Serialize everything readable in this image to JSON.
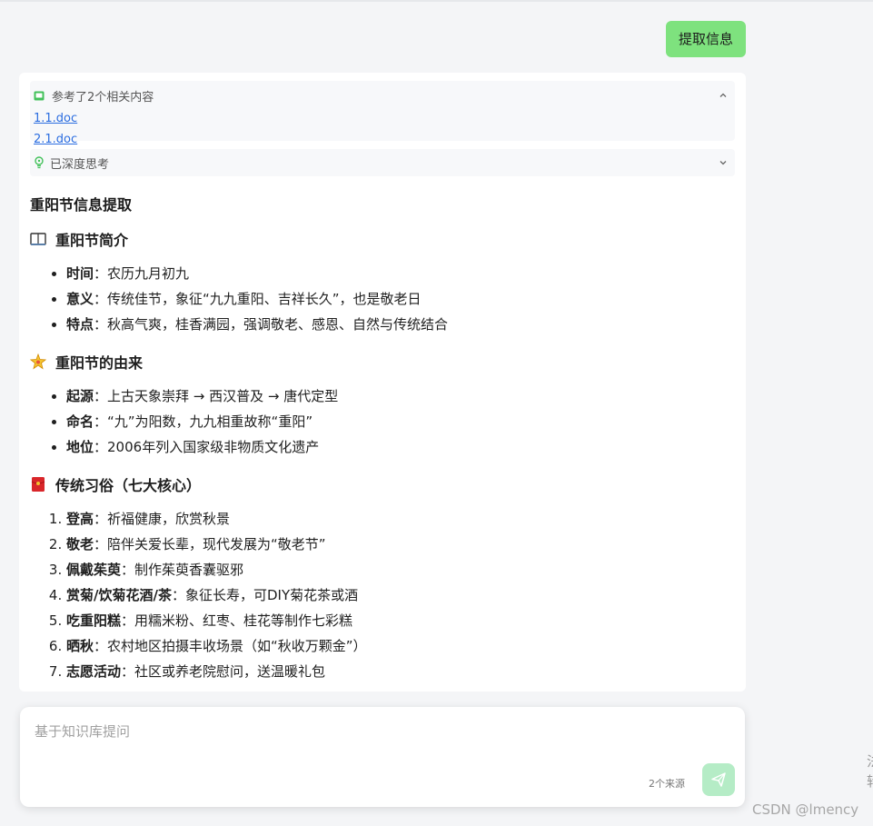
{
  "toolbar": {
    "extract_label": "提取信息"
  },
  "references": {
    "heading": "参考了2个相关内容",
    "files": [
      "1.1.doc",
      "2.1.doc"
    ]
  },
  "thinking": {
    "label": "已深度思考"
  },
  "answer": {
    "title": "重阳节信息提取",
    "sections": [
      {
        "heading": "重阳节简介",
        "icon": "book-icon",
        "items": [
          {
            "key": "时间",
            "value": "：农历九月初九"
          },
          {
            "key": "意义",
            "value": "：传统佳节，象征“九九重阳、吉祥长久”，也是敬老日"
          },
          {
            "key": "特点",
            "value": "：秋高气爽，桂香满园，强调敬老、感恩、自然与传统结合"
          }
        ]
      },
      {
        "heading": "重阳节的由来",
        "icon": "sparkle-icon",
        "items": [
          {
            "key": "起源",
            "value": "：上古天象崇拜 → 西汉普及 → 唐代定型"
          },
          {
            "key": "命名",
            "value": "：“九”为阳数，九九相重故称“重阳”"
          },
          {
            "key": "地位",
            "value": "：2006年列入国家级非物质文化遗产"
          }
        ]
      },
      {
        "heading": "传统习俗（七大核心）",
        "icon": "red-envelope-icon",
        "items": [
          {
            "key": "登高",
            "value": "：祈福健康，欣赏秋景"
          },
          {
            "key": "敬老",
            "value": "：陪伴关爱长辈，现代发展为“敬老节”"
          },
          {
            "key": "佩戴茱萸",
            "value": "：制作茱萸香囊驱邪"
          },
          {
            "key": "赏菊/饮菊花酒/茶",
            "value": "：象征长寿，可DIY菊花茶或酒"
          },
          {
            "key": "吃重阳糕",
            "value": "：用糯米粉、红枣、桂花等制作七彩糕"
          },
          {
            "key": "晒秋",
            "value": "：农村地区拍摄丰收场景（如“秋收万颗金”）"
          },
          {
            "key": "志愿活动",
            "value": "：社区或养老院慰问，送温暖礼包"
          }
        ]
      }
    ]
  },
  "input": {
    "placeholder": "基于知识库提问",
    "source_count": "2个来源"
  },
  "watermark": "CSDN @lmency",
  "edge_glyphs": "法\n转",
  "colors": {
    "accent": "#7ee27e",
    "send": "#b5ecc6",
    "link": "#2b6de0"
  }
}
